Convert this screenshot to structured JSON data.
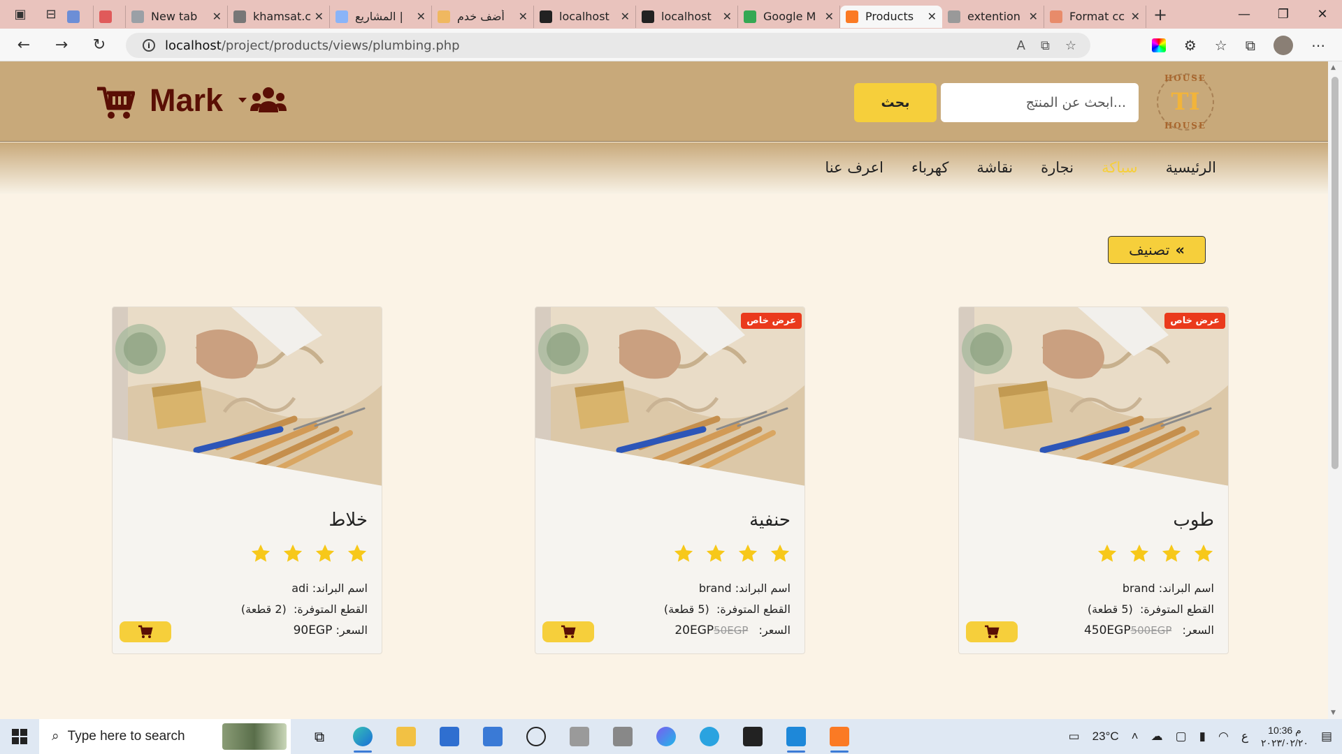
{
  "browser": {
    "tabs": [
      {
        "title": "",
        "color": "#6c8ed6"
      },
      {
        "title": "",
        "color": "#e05a5a"
      },
      {
        "title": "New tab",
        "color": "#9aa0a6"
      },
      {
        "title": "khamsat.c",
        "color": "#777777"
      },
      {
        "title": "المشاريع |",
        "color": "#8ab4f8"
      },
      {
        "title": "أضف خدم",
        "color": "#f0b860"
      },
      {
        "title": "localhost",
        "color": "#222222"
      },
      {
        "title": "localhost",
        "color": "#222222"
      },
      {
        "title": "Google M",
        "color": "#34a853"
      },
      {
        "title": "Products",
        "color": "#fb7a24"
      },
      {
        "title": "extention",
        "color": "#999999"
      },
      {
        "title": "Format cc",
        "color": "#e88b6a"
      }
    ],
    "url_host": "localhost",
    "url_path": "/project/products/views/plumbing.php"
  },
  "header": {
    "logo_top": "HOUSE",
    "logo_bottom": "HOUSE",
    "search_placeholder": "ابحث عن المنتج...",
    "search_button": "بحث",
    "brand_name": "Mark"
  },
  "nav": {
    "items": [
      "الرئيسية",
      "سباكة",
      "نجارة",
      "نقاشة",
      "كهرباء",
      "اعرف عنا"
    ],
    "active_index": 1
  },
  "filter": {
    "classify_label": "تصنيف"
  },
  "products": [
    {
      "name": "طوب",
      "badge": "عرض خاص",
      "rating": 4,
      "brand_label": "اسم البراند:",
      "brand": "brand",
      "stock_label": "القطع المتوفرة:",
      "stock": "(5 قطعة)",
      "price_label": "السعر:",
      "price": "450EGP",
      "old_price": "500EGP"
    },
    {
      "name": "حنفية",
      "badge": "عرض خاص",
      "rating": 4,
      "brand_label": "اسم البراند:",
      "brand": "brand",
      "stock_label": "القطع المتوفرة:",
      "stock": "(5 قطعة)",
      "price_label": "السعر:",
      "price": "20EGP",
      "old_price": "50EGP"
    },
    {
      "name": "خلاط",
      "badge": "",
      "rating": 4,
      "brand_label": "اسم البراند:",
      "brand": "adi",
      "stock_label": "القطع المتوفرة:",
      "stock": "(2 قطعة)",
      "price_label": "السعر:",
      "price": "90EGP",
      "old_price": ""
    }
  ],
  "taskbar": {
    "search_placeholder": "Type here to search",
    "temperature": "23°C",
    "lang": "ع",
    "time": "10:36 م",
    "date": "٢٠٢٣/٠٢/٢٠"
  },
  "colors": {
    "header_bg": "#c8a97a",
    "accent_yellow": "#f6cf3b",
    "brand_dark": "#5a0f05",
    "badge_red": "#ea3a1c",
    "page_bg": "#fbf3e6"
  }
}
